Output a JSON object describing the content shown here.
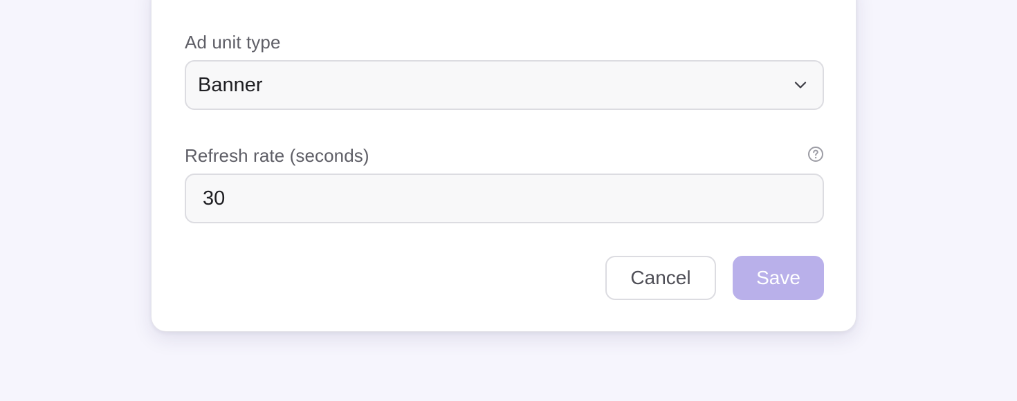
{
  "form": {
    "ad_unit_type": {
      "label": "Ad unit type",
      "selected_value": "Banner",
      "dropdown_icon": "chevron-down-icon"
    },
    "refresh_rate": {
      "label": "Refresh rate (seconds)",
      "value": "30",
      "help_icon": "question-circle-icon"
    }
  },
  "actions": {
    "cancel_label": "Cancel",
    "save_label": "Save",
    "save_disabled": true
  },
  "colors": {
    "page_background": "#f6f5fd",
    "card_background": "#ffffff",
    "input_background": "#f8f8f9",
    "input_border": "#dcdce1",
    "save_button_disabled": "#b9b0ea",
    "label_text": "#5e5e66",
    "value_text": "#1e1e22"
  }
}
